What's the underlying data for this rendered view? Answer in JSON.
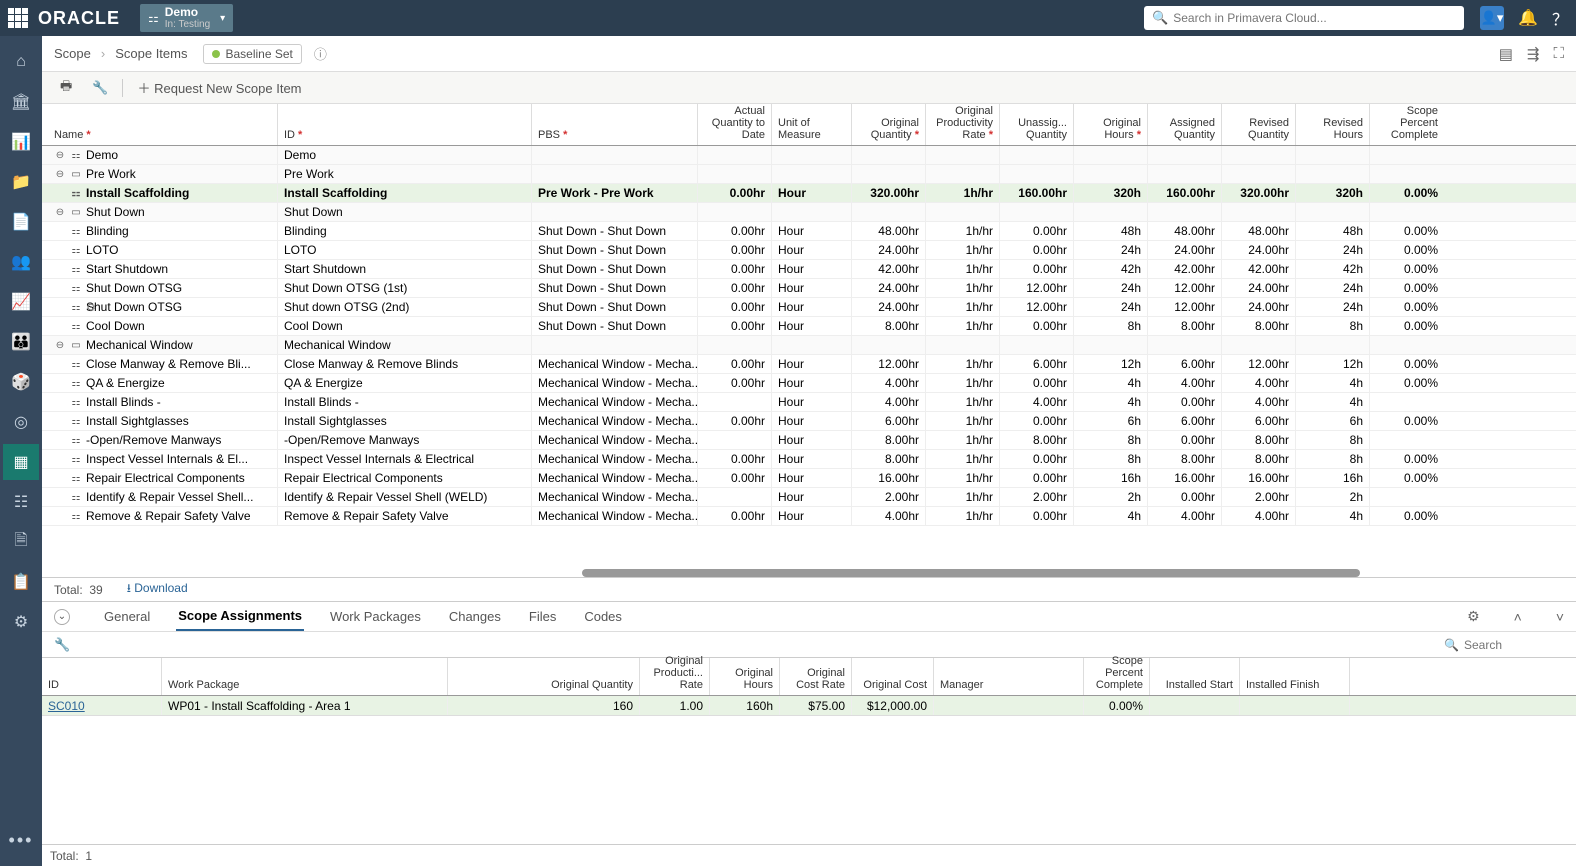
{
  "header": {
    "brand": "ORACLE",
    "env": {
      "name": "Demo",
      "sub": "In: Testing"
    },
    "search_placeholder": "Search in Primavera Cloud..."
  },
  "breadcrumb": {
    "a": "Scope",
    "b": "Scope Items",
    "baseline": "Baseline Set"
  },
  "toolbar": {
    "request": "Request New Scope Item"
  },
  "columns": {
    "name": "Name",
    "id": "ID",
    "pbs": "PBS",
    "aqtd": "Actual Quantity to Date",
    "uom": "Unit of Measure",
    "oq": "Original Quantity",
    "opr": "Original Productivity Rate",
    "uaq": "Unassig... Quantity",
    "oh": "Original Hours",
    "aq": "Assigned Quantity",
    "rq": "Revised Quantity",
    "rh": "Revised Hours",
    "spc": "Scope Percent Complete"
  },
  "rows": [
    {
      "type": "group",
      "lvl": 0,
      "name": "Demo",
      "id": "Demo"
    },
    {
      "type": "group",
      "lvl": 1,
      "name": "Pre Work",
      "id": "Pre Work"
    },
    {
      "type": "item",
      "lvl": 2,
      "sel": true,
      "name": "Install Scaffolding",
      "id": "Install Scaffolding",
      "pbs": "Pre Work - Pre Work",
      "aqtd": "0.00hr",
      "uom": "Hour",
      "oq": "320.00hr",
      "opr": "1h/hr",
      "uaq": "160.00hr",
      "oh": "320h",
      "aq": "160.00hr",
      "rq": "320.00hr",
      "rh": "320h",
      "spc": "0.00%"
    },
    {
      "type": "group",
      "lvl": 1,
      "name": "Shut Down",
      "id": "Shut Down"
    },
    {
      "type": "item",
      "lvl": 2,
      "name": "Blinding",
      "id": "Blinding",
      "pbs": "Shut Down - Shut Down",
      "aqtd": "0.00hr",
      "uom": "Hour",
      "oq": "48.00hr",
      "opr": "1h/hr",
      "uaq": "0.00hr",
      "oh": "48h",
      "aq": "48.00hr",
      "rq": "48.00hr",
      "rh": "48h",
      "spc": "0.00%"
    },
    {
      "type": "item",
      "lvl": 2,
      "name": "LOTO",
      "id": "LOTO",
      "pbs": "Shut Down - Shut Down",
      "aqtd": "0.00hr",
      "uom": "Hour",
      "oq": "24.00hr",
      "opr": "1h/hr",
      "uaq": "0.00hr",
      "oh": "24h",
      "aq": "24.00hr",
      "rq": "24.00hr",
      "rh": "24h",
      "spc": "0.00%"
    },
    {
      "type": "item",
      "lvl": 2,
      "name": "Start Shutdown",
      "id": "Start Shutdown",
      "pbs": "Shut Down - Shut Down",
      "aqtd": "0.00hr",
      "uom": "Hour",
      "oq": "42.00hr",
      "opr": "1h/hr",
      "uaq": "0.00hr",
      "oh": "42h",
      "aq": "42.00hr",
      "rq": "42.00hr",
      "rh": "42h",
      "spc": "0.00%"
    },
    {
      "type": "item",
      "lvl": 2,
      "name": "Shut Down OTSG",
      "id": "Shut Down OTSG (1st)",
      "pbs": "Shut Down - Shut Down",
      "aqtd": "0.00hr",
      "uom": "Hour",
      "oq": "24.00hr",
      "opr": "1h/hr",
      "uaq": "12.00hr",
      "oh": "24h",
      "aq": "12.00hr",
      "rq": "24.00hr",
      "rh": "24h",
      "spc": "0.00%"
    },
    {
      "type": "item",
      "lvl": 2,
      "gear": true,
      "name": "Shut Down OTSG",
      "id": "Shut down OTSG (2nd)",
      "pbs": "Shut Down - Shut Down",
      "aqtd": "0.00hr",
      "uom": "Hour",
      "oq": "24.00hr",
      "opr": "1h/hr",
      "uaq": "12.00hr",
      "oh": "24h",
      "aq": "12.00hr",
      "rq": "24.00hr",
      "rh": "24h",
      "spc": "0.00%"
    },
    {
      "type": "item",
      "lvl": 2,
      "name": "Cool Down",
      "id": "Cool Down",
      "pbs": "Shut Down - Shut Down",
      "aqtd": "0.00hr",
      "uom": "Hour",
      "oq": "8.00hr",
      "opr": "1h/hr",
      "uaq": "0.00hr",
      "oh": "8h",
      "aq": "8.00hr",
      "rq": "8.00hr",
      "rh": "8h",
      "spc": "0.00%"
    },
    {
      "type": "group",
      "lvl": 1,
      "name": "Mechanical Window",
      "id": "Mechanical Window"
    },
    {
      "type": "item",
      "lvl": 2,
      "name": "Close Manway & Remove Bli...",
      "id": "Close Manway & Remove Blinds",
      "pbs": "Mechanical Window - Mecha...",
      "aqtd": "0.00hr",
      "uom": "Hour",
      "oq": "12.00hr",
      "opr": "1h/hr",
      "uaq": "6.00hr",
      "oh": "12h",
      "aq": "6.00hr",
      "rq": "12.00hr",
      "rh": "12h",
      "spc": "0.00%"
    },
    {
      "type": "item",
      "lvl": 2,
      "name": "QA & Energize",
      "id": "QA & Energize",
      "pbs": "Mechanical Window - Mecha...",
      "aqtd": "0.00hr",
      "uom": "Hour",
      "oq": "4.00hr",
      "opr": "1h/hr",
      "uaq": "0.00hr",
      "oh": "4h",
      "aq": "4.00hr",
      "rq": "4.00hr",
      "rh": "4h",
      "spc": "0.00%"
    },
    {
      "type": "item",
      "lvl": 2,
      "name": "Install Blinds -",
      "id": "Install Blinds -",
      "pbs": "Mechanical Window - Mecha...",
      "aqtd": "",
      "uom": "Hour",
      "oq": "4.00hr",
      "opr": "1h/hr",
      "uaq": "4.00hr",
      "oh": "4h",
      "aq": "0.00hr",
      "rq": "4.00hr",
      "rh": "4h",
      "spc": ""
    },
    {
      "type": "item",
      "lvl": 2,
      "name": "Install Sightglasses",
      "id": "Install Sightglasses",
      "pbs": "Mechanical Window - Mecha...",
      "aqtd": "0.00hr",
      "uom": "Hour",
      "oq": "6.00hr",
      "opr": "1h/hr",
      "uaq": "0.00hr",
      "oh": "6h",
      "aq": "6.00hr",
      "rq": "6.00hr",
      "rh": "6h",
      "spc": "0.00%"
    },
    {
      "type": "item",
      "lvl": 2,
      "name": "-Open/Remove Manways",
      "id": "-Open/Remove Manways",
      "pbs": "Mechanical Window - Mecha...",
      "aqtd": "",
      "uom": "Hour",
      "oq": "8.00hr",
      "opr": "1h/hr",
      "uaq": "8.00hr",
      "oh": "8h",
      "aq": "0.00hr",
      "rq": "8.00hr",
      "rh": "8h",
      "spc": ""
    },
    {
      "type": "item",
      "lvl": 2,
      "name": "Inspect Vessel Internals & El...",
      "id": "Inspect Vessel Internals & Electrical",
      "pbs": "Mechanical Window - Mecha...",
      "aqtd": "0.00hr",
      "uom": "Hour",
      "oq": "8.00hr",
      "opr": "1h/hr",
      "uaq": "0.00hr",
      "oh": "8h",
      "aq": "8.00hr",
      "rq": "8.00hr",
      "rh": "8h",
      "spc": "0.00%"
    },
    {
      "type": "item",
      "lvl": 2,
      "name": "Repair Electrical Components",
      "id": "Repair Electrical Components",
      "pbs": "Mechanical Window - Mecha...",
      "aqtd": "0.00hr",
      "uom": "Hour",
      "oq": "16.00hr",
      "opr": "1h/hr",
      "uaq": "0.00hr",
      "oh": "16h",
      "aq": "16.00hr",
      "rq": "16.00hr",
      "rh": "16h",
      "spc": "0.00%"
    },
    {
      "type": "item",
      "lvl": 2,
      "name": "Identify & Repair Vessel Shell...",
      "id": "Identify & Repair Vessel Shell (WELD)",
      "pbs": "Mechanical Window - Mecha...",
      "aqtd": "",
      "uom": "Hour",
      "oq": "2.00hr",
      "opr": "1h/hr",
      "uaq": "2.00hr",
      "oh": "2h",
      "aq": "0.00hr",
      "rq": "2.00hr",
      "rh": "2h",
      "spc": ""
    },
    {
      "type": "item",
      "lvl": 2,
      "name": "Remove & Repair Safety Valve",
      "id": "Remove & Repair Safety Valve",
      "pbs": "Mechanical Window - Mecha...",
      "aqtd": "0.00hr",
      "uom": "Hour",
      "oq": "4.00hr",
      "opr": "1h/hr",
      "uaq": "0.00hr",
      "oh": "4h",
      "aq": "4.00hr",
      "rq": "4.00hr",
      "rh": "4h",
      "spc": "0.00%"
    }
  ],
  "footer": {
    "total_label": "Total:",
    "total": "39",
    "download": "Download"
  },
  "tabs": {
    "general": "General",
    "sa": "Scope Assignments",
    "wp": "Work Packages",
    "ch": "Changes",
    "files": "Files",
    "codes": "Codes"
  },
  "dcols": {
    "id": "ID",
    "wp": "Work Package",
    "oq": "Original Quantity",
    "opr": "Original Producti... Rate",
    "oh": "Original Hours",
    "ocr": "Original Cost Rate",
    "oc": "Original Cost",
    "mgr": "Manager",
    "spc": "Scope Percent Complete",
    "is": "Installed Start",
    "if": "Installed Finish"
  },
  "drow": {
    "id": "SC010",
    "wp": "WP01 - Install Scaffolding - Area 1",
    "oq": "160",
    "opr": "1.00",
    "oh": "160h",
    "ocr": "$75.00",
    "oc": "$12,000.00",
    "mgr": "",
    "spc": "0.00%",
    "is": "",
    "if": ""
  },
  "dfooter": {
    "total_label": "Total:",
    "total": "1"
  },
  "dsearch_placeholder": "Search"
}
